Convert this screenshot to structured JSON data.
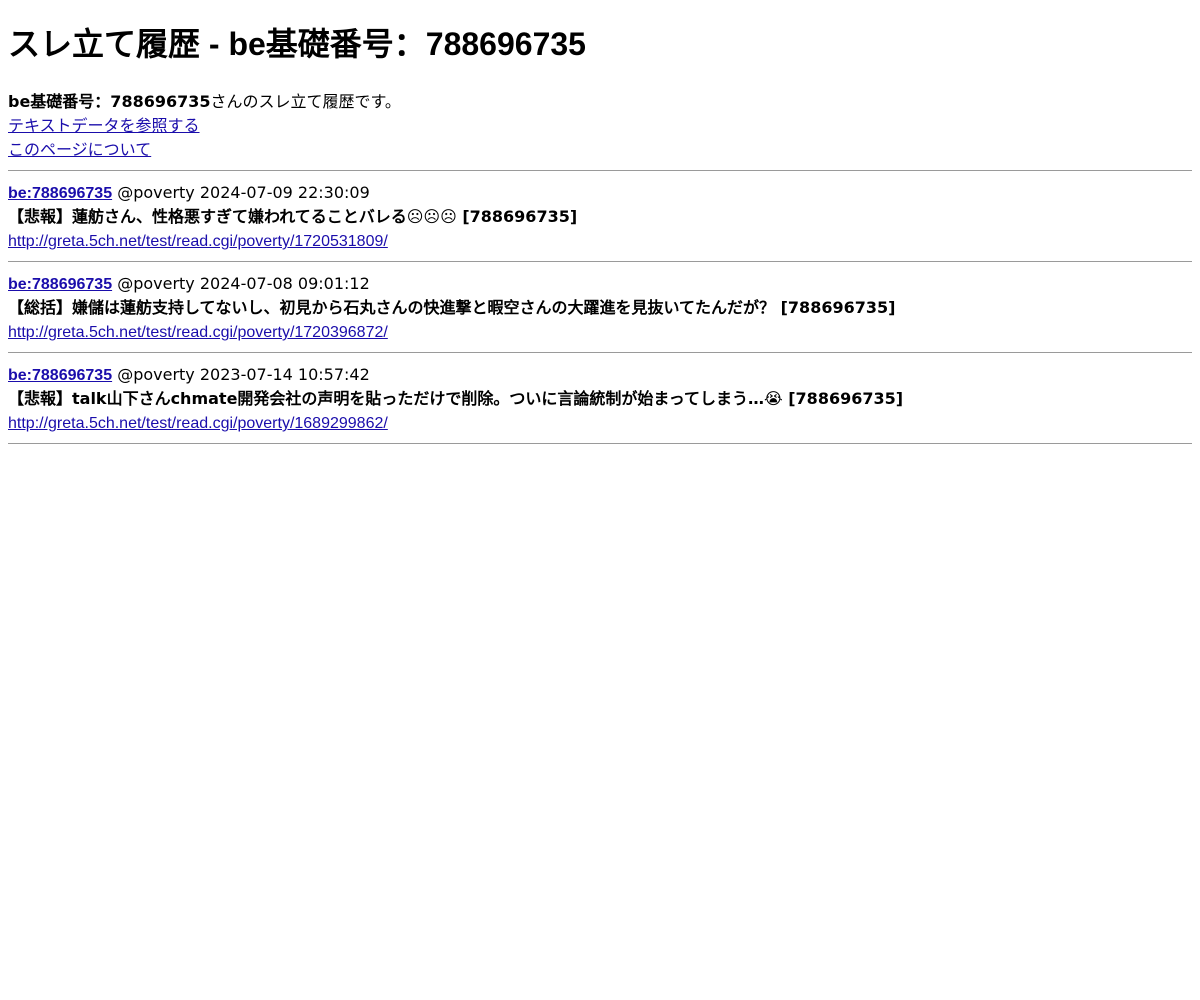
{
  "page": {
    "title": "スレ立て履歴 - be基礎番号：788696735"
  },
  "intro": {
    "label_bold": "be基礎番号：788696735",
    "label_rest": "さんのスレ立て履歴です。",
    "links": [
      {
        "text": "テキストデータを参照する"
      },
      {
        "text": "このページについて"
      }
    ]
  },
  "entries": [
    {
      "be_label": "be:788696735",
      "board": "@poverty",
      "timestamp": "2024-07-09 22:30:09",
      "title": "【悲報】蓮舫さん、性格悪すぎて嫌われてることバレる☹☹☹ [788696735]",
      "url": "http://greta.5ch.net/test/read.cgi/poverty/1720531809/"
    },
    {
      "be_label": "be:788696735",
      "board": "@poverty",
      "timestamp": "2024-07-08 09:01:12",
      "title": "【総括】嫌儲は蓮舫支持してないし、初見から石丸さんの快進撃と暇空さんの大躍進を見抜いてたんだが？ [788696735]",
      "url": "http://greta.5ch.net/test/read.cgi/poverty/1720396872/"
    },
    {
      "be_label": "be:788696735",
      "board": "@poverty",
      "timestamp": "2023-07-14 10:57:42",
      "title": "【悲報】talk山下さんchmate開発会社の声明を貼っただけで削除。ついに言論統制が始まってしまう…😭 [788696735]",
      "url": "http://greta.5ch.net/test/read.cgi/poverty/1689299862/"
    }
  ]
}
